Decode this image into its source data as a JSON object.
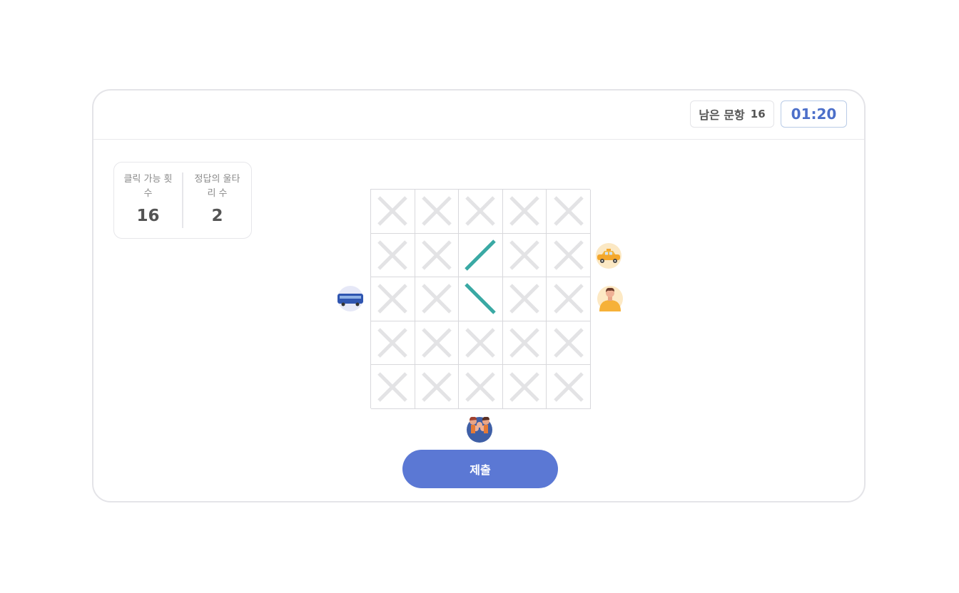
{
  "header": {
    "remaining_label": "남은 문항",
    "remaining_count": "16",
    "timer": "01:20"
  },
  "stats": {
    "clicks_label": "클릭 가능 횟수",
    "clicks_value": "16",
    "answer_fence_label": "정답의 울타리 수",
    "answer_fence_value": "2"
  },
  "board": {
    "rows": 5,
    "cols": 5,
    "cells": [
      [
        "x",
        "x",
        "x",
        "x",
        "x"
      ],
      [
        "x",
        "x",
        "slash",
        "x",
        "x"
      ],
      [
        "x",
        "x",
        "backslash",
        "x",
        "x"
      ],
      [
        "x",
        "x",
        "x",
        "x",
        "x"
      ],
      [
        "x",
        "x",
        "x",
        "x",
        "x"
      ]
    ]
  },
  "characters": [
    {
      "name": "taxi-icon",
      "side": "right",
      "row": 1
    },
    {
      "name": "bus-icon",
      "side": "left",
      "row": 2
    },
    {
      "name": "person-icon",
      "side": "right",
      "row": 2
    },
    {
      "name": "group-people-icon",
      "side": "bottom",
      "col": 2
    }
  ],
  "submit_label": "제출",
  "colors": {
    "accent": "#5b78d4",
    "timer": "#4c6fc9",
    "fence": "#3aa9a4",
    "x_mark": "#e3e3e5"
  }
}
